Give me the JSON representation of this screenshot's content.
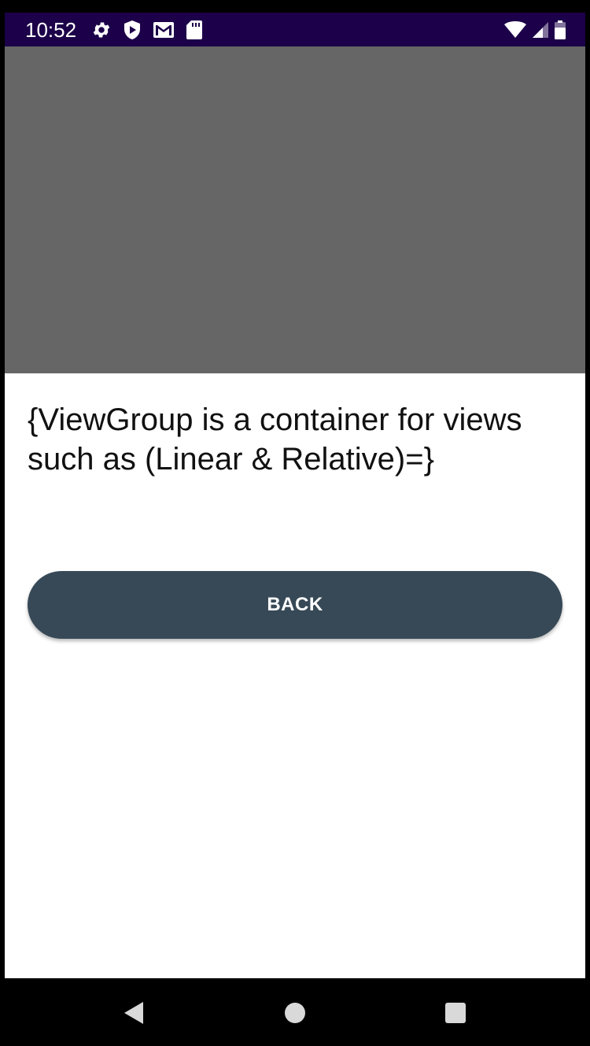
{
  "status_bar": {
    "time": "10:52",
    "left_icons": [
      "settings-icon",
      "shield-icon",
      "gmail-icon",
      "sd-card-icon"
    ],
    "right_icons": [
      "wifi-icon",
      "cell-signal-icon",
      "battery-icon"
    ],
    "background_color": "#1c0049"
  },
  "main": {
    "media_placeholder_color": "#666666",
    "description": "{ViewGroup is a container for views such as (Linear & Relative)=}",
    "back_button_label": "BACK",
    "back_button_color": "#374957"
  },
  "nav_bar": {
    "buttons": [
      "back-triangle-icon",
      "home-circle-icon",
      "recents-square-icon"
    ]
  }
}
